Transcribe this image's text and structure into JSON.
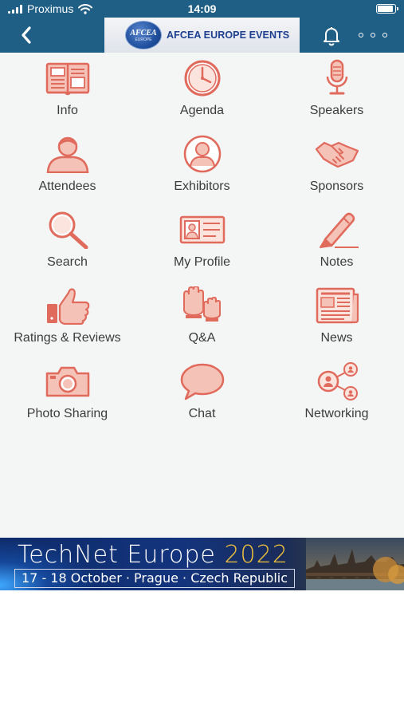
{
  "status_bar": {
    "carrier": "Proximus",
    "time": "14:09"
  },
  "nav": {
    "logo_emblem": "AFCEA",
    "logo_emblem_sub": "EUROPE",
    "logo_title": "AFCEA EUROPE EVENTS",
    "icons": {
      "back": "chevron-left-icon",
      "bell": "bell-icon",
      "more": "more-dots-icon"
    }
  },
  "accent_color": "#e06a5c",
  "header_color": "#1f5f86",
  "menu": [
    {
      "label": "Info",
      "icon": "open-book-icon"
    },
    {
      "label": "Agenda",
      "icon": "clock-icon"
    },
    {
      "label": "Speakers",
      "icon": "microphone-icon"
    },
    {
      "label": "Attendees",
      "icon": "person-icon"
    },
    {
      "label": "Exhibitors",
      "icon": "person-circle-icon"
    },
    {
      "label": "Sponsors",
      "icon": "handshake-icon"
    },
    {
      "label": "Search",
      "icon": "magnifier-icon"
    },
    {
      "label": "My Profile",
      "icon": "id-card-icon"
    },
    {
      "label": "Notes",
      "icon": "pen-icon"
    },
    {
      "label": "Ratings & Reviews",
      "icon": "thumbs-up-icon"
    },
    {
      "label": "Q&A",
      "icon": "raised-hands-icon"
    },
    {
      "label": "News",
      "icon": "newspaper-icon"
    },
    {
      "label": "Photo Sharing",
      "icon": "camera-icon"
    },
    {
      "label": "Chat",
      "icon": "chat-bubble-icon"
    },
    {
      "label": "Networking",
      "icon": "network-icon"
    }
  ],
  "ad": {
    "title": "TechNet Europe ",
    "year": "2022",
    "subtitle": "17 - 18 October · Prague · Czech Republic"
  }
}
